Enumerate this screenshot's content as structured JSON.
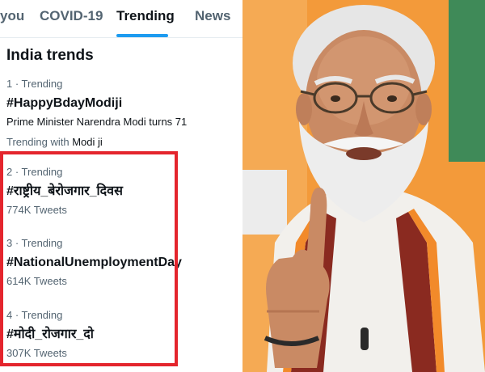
{
  "tabs": [
    {
      "label": "you"
    },
    {
      "label": "COVID-19"
    },
    {
      "label": "Trending",
      "active": true
    },
    {
      "label": "News"
    }
  ],
  "section_title": "India trends",
  "trends": [
    {
      "rank": "1 · Trending",
      "tag": "#HappyBdayModiji",
      "description": "Prime Minister Narendra Modi turns 71",
      "with_prefix": "Trending with",
      "with_value": "Modi ji"
    },
    {
      "rank": "2 · Trending",
      "tag": "#राष्ट्रीय_बेरोजगार_दिवस",
      "count": "774K Tweets"
    },
    {
      "rank": "3 · Trending",
      "tag": "#NationalUnemploymentDay",
      "count": "614K Tweets"
    },
    {
      "rank": "4 · Trending",
      "tag": "#मोदी_रोजगार_दो",
      "count": "307K Tweets"
    }
  ],
  "colors": {
    "accent": "#1d9bf0",
    "highlight": "#e4252d",
    "backdrop_orange": "#f39a3a",
    "backdrop_green": "#3f8a58"
  }
}
